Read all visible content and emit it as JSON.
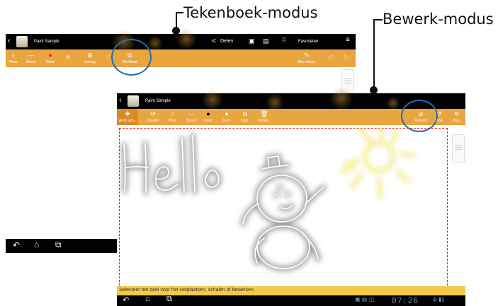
{
  "callouts": {
    "tekenboek": "Tekenboek-modus",
    "bewerk": "Bewerk-modus"
  },
  "top_app": {
    "title": "Paint Sample",
    "actions": {
      "share": "Delen",
      "favorites": "Favorieten"
    },
    "tools": [
      {
        "label": "Pens.",
        "icon": "circle-icon"
      },
      {
        "label": "Streek",
        "icon": "stroke-icon"
      },
      {
        "label": "Kleur",
        "icon": "color-dot-icon"
      },
      {
        "label": "",
        "icon": "disabled-icon"
      },
      {
        "label": "Invoeg",
        "icon": "insert-icon"
      },
      {
        "label": "",
        "icon": "disabled-icon"
      },
      {
        "label": "Werkblad",
        "icon": "worksheet-icon"
      }
    ],
    "right_tools": [
      {
        "label": "Alles uitsch."
      },
      {
        "label": ""
      },
      {
        "label": ""
      }
    ]
  },
  "edit_app": {
    "title": "Paint Sample",
    "tools": [
      {
        "label": "Verpl./sch...",
        "icon": "move-icon",
        "active": true
      },
      {
        "label": "Draaien",
        "icon": "rotate-icon"
      },
      {
        "label": "Pens.",
        "icon": "circle-icon"
      },
      {
        "label": "Streek",
        "icon": "stroke-icon"
      },
      {
        "label": "Kleur",
        "icon": "color-dot-icon"
      },
      {
        "label": "Gum",
        "icon": "eraser-icon"
      },
      {
        "label": "Dupl.",
        "icon": "duplicate-icon"
      },
      {
        "label": "Verwij...",
        "icon": "delete-icon"
      }
    ],
    "right_tools": [
      {
        "label": "Gereed",
        "icon": "check-icon"
      },
      {
        "label": "Ome.",
        "icon": "undo-icon"
      },
      {
        "label": "Ong...",
        "icon": "redo-icon"
      }
    ],
    "status": "Selecteer het doel voor het verplaatsen, schalen of bewerken.",
    "clock": "07:26"
  },
  "colors": {
    "toolbar": "#e9a640",
    "highlight": "#1f6fb5",
    "selection": "#e0201a",
    "sun": "#f0e57a"
  }
}
